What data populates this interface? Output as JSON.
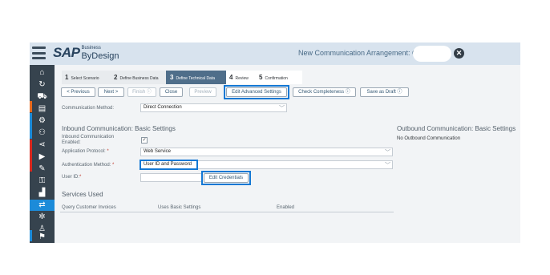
{
  "header": {
    "logo_sap": "SAP",
    "logo_business": "Business",
    "logo_bydesign": "ByDesign",
    "title": "New Communication Arrangement: CS"
  },
  "nav": {
    "icons": [
      "home-icon",
      "refresh-icon",
      "truck-icon",
      "document-forward-icon",
      "service-icon",
      "people-icon",
      "share-icon",
      "play-icon",
      "tools-icon",
      "user-key-icon",
      "bar-chart-icon",
      "connect-icon",
      "gears-icon",
      "person-icon",
      "flag-icon"
    ],
    "colors": {
      "bg": "#36434e",
      "orange": "#e86a1e",
      "blue": "#1c8bd9",
      "red": "#d9281e"
    }
  },
  "steps": [
    {
      "num": "1",
      "label": "Select Scenario"
    },
    {
      "num": "2",
      "label": "Define Business Data"
    },
    {
      "num": "3",
      "label": "Define Technical Data"
    },
    {
      "num": "4",
      "label": "Review"
    },
    {
      "num": "5",
      "label": "Confirmation"
    }
  ],
  "toolbar": {
    "previous": "< Previous",
    "next": "Next >",
    "finish": "Finish ⓘ",
    "close": "Close",
    "preview": "Preview",
    "edit_advanced": "Edit Advanced Settings",
    "check_completeness": "Check Completeness ⓘ",
    "save_draft": "Save as Draft ⓘ"
  },
  "form": {
    "comm_method_label": "Communication Method:",
    "comm_method_value": "Direct Connection",
    "inbound_title": "Inbound Communication: Basic Settings",
    "inbound_enabled_label": "Inbound Communication Enabled:",
    "inbound_enabled_check": "✓",
    "app_protocol_label": "Application Protocol:",
    "app_protocol_value": "Web Service",
    "auth_method_label": "Authentication Method:",
    "auth_method_value": "User ID and Password",
    "user_id_label": "User ID:",
    "required_mark": "*",
    "edit_credentials": "Edit Credentials",
    "outbound_title": "Outbound Communication: Basic Settings",
    "outbound_text": "No Outbound Communication"
  },
  "services": {
    "title": "Services Used",
    "row": [
      "Query Customer Invoices",
      "Uses Basic Settings",
      "Enabled"
    ]
  }
}
